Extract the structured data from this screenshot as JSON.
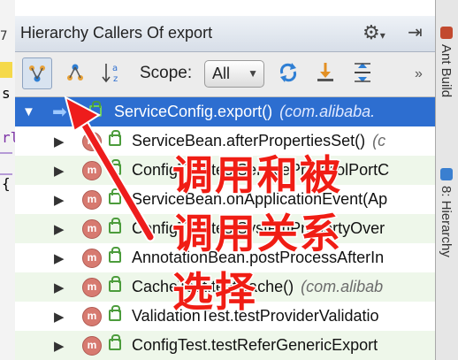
{
  "editor": {
    "line_digit": "7",
    "fragments": [
      "s",
      "rl",
      "{"
    ]
  },
  "window": {
    "title": "Hierarchy Callers Of export",
    "gear_icon": "gear-icon",
    "pin_icon": "pin-icon"
  },
  "toolbar": {
    "scope_label": "Scope:",
    "scope_value": "All",
    "more_label": "»"
  },
  "tree": {
    "rows": [
      {
        "text": "ServiceConfig.export()",
        "pkg": "(com.alibaba.",
        "selected": true
      },
      {
        "text": "ServiceBean.afterPropertiesSet()",
        "pkg": "(c"
      },
      {
        "text": "ConfigTest.testServiceProtocolPortC",
        "pkg": ""
      },
      {
        "text": "ServiceBean.onApplicationEvent(Ap",
        "pkg": ""
      },
      {
        "text": "ConfigTest.testSystemPropertyOver",
        "pkg": ""
      },
      {
        "text": "AnnotationBean.postProcessAfterIn",
        "pkg": ""
      },
      {
        "text": "CacheTest.testCache()",
        "pkg": "(com.alibab"
      },
      {
        "text": "ValidationTest.testProviderValidatio",
        "pkg": ""
      },
      {
        "text": "ConfigTest.testReferGenericExport",
        "pkg": ""
      }
    ]
  },
  "annotation": {
    "line1": "调用和被",
    "line2": "调用关系",
    "line3": "选择",
    "color": "#f01d14"
  },
  "sidebar": {
    "ant_build": "Ant Build",
    "hierarchy": "8: Hierarchy"
  }
}
